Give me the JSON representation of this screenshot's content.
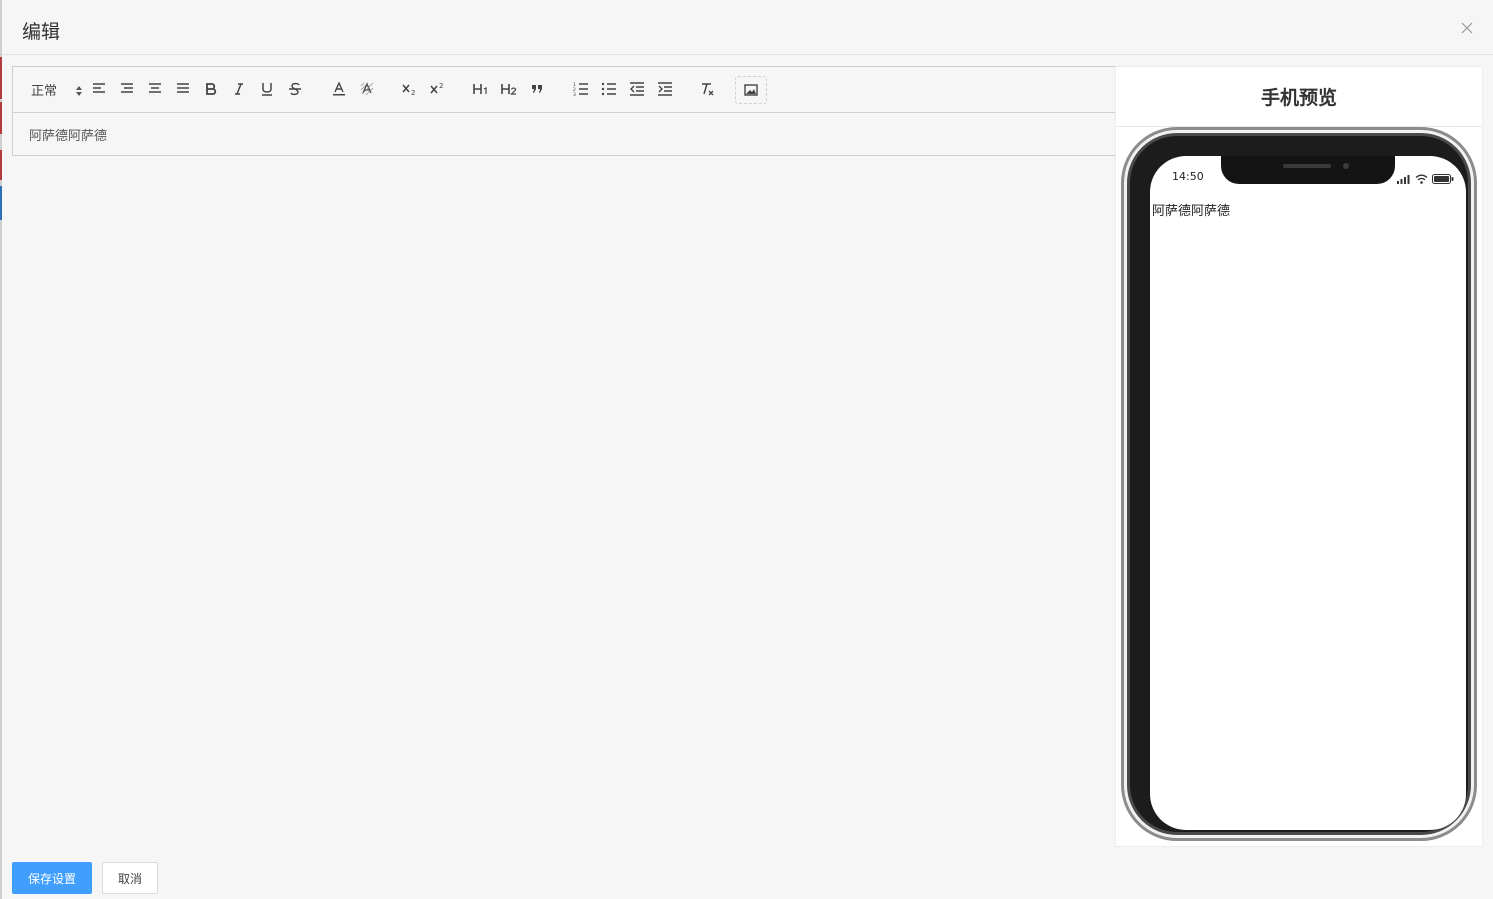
{
  "dialog": {
    "title": "编辑",
    "close_icon": "close-icon"
  },
  "toolbar": {
    "header_select": "正常",
    "icons": [
      "align-left-icon",
      "align-center-icon",
      "align-right-icon",
      "align-justify-icon",
      "bold-icon",
      "italic-icon",
      "underline-icon",
      "strikethrough-icon",
      "font-color-icon",
      "background-color-icon",
      "subscript-icon",
      "superscript-icon",
      "heading-1-icon",
      "heading-2-icon",
      "blockquote-icon",
      "ordered-list-icon",
      "bullet-list-icon",
      "outdent-icon",
      "indent-icon",
      "clear-format-icon",
      "image-icon"
    ]
  },
  "editor": {
    "content": "阿萨德阿萨德"
  },
  "preview": {
    "title": "手机预览",
    "status_time": "14:50",
    "content": "阿萨德阿萨德"
  },
  "footer": {
    "save_label": "保存设置",
    "cancel_label": "取消"
  },
  "colors": {
    "primary": "#409eff",
    "background": "#f6f6f6"
  }
}
